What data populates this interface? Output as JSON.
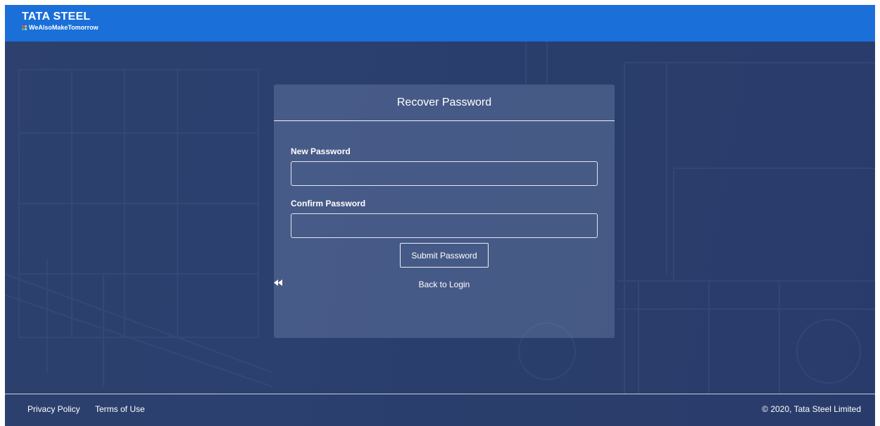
{
  "header": {
    "logo_text": "TATA STEEL",
    "tagline": "WeAlsoMakeTomorrow"
  },
  "form": {
    "title": "Recover Password",
    "new_password_label": "New Password",
    "new_password_value": "",
    "confirm_password_label": "Confirm Password",
    "confirm_password_value": "",
    "submit_label": "Submit Password",
    "back_label": "Back to Login",
    "back_icon": "rewind-icon"
  },
  "footer": {
    "privacy": "Privacy Policy",
    "terms": "Terms of Use",
    "copyright": "© 2020, Tata Steel Limited"
  },
  "colors": {
    "topbar": "#1a6fd9",
    "background": "#2d4270"
  }
}
